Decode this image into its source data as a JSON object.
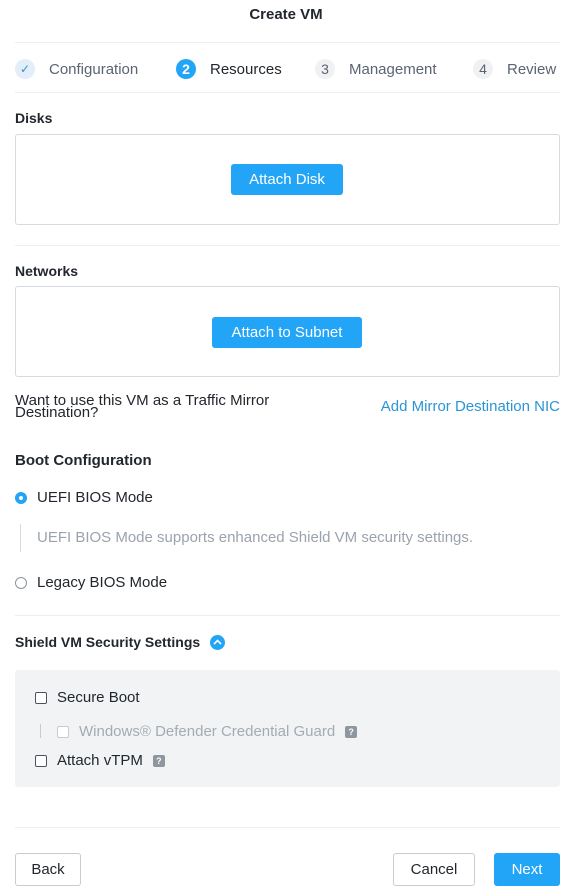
{
  "modal": {
    "title": "Create VM"
  },
  "stepper": {
    "steps": [
      {
        "label": "Configuration",
        "marker": "✓",
        "state": "done"
      },
      {
        "label": "Resources",
        "marker": "2",
        "state": "active"
      },
      {
        "label": "Management",
        "marker": "3",
        "state": "todo"
      },
      {
        "label": "Review",
        "marker": "4",
        "state": "todo"
      }
    ]
  },
  "disks": {
    "label": "Disks",
    "button": "Attach Disk"
  },
  "networks": {
    "label": "Networks",
    "button": "Attach to Subnet"
  },
  "mirror": {
    "question": "Want to use this VM as a Traffic Mirror Destination?",
    "link": "Add Mirror Destination NIC"
  },
  "boot": {
    "label": "Boot Configuration",
    "options": [
      {
        "label": "UEFI BIOS Mode",
        "selected": true
      },
      {
        "label": "Legacy BIOS Mode",
        "selected": false
      }
    ],
    "uefi_description": "UEFI BIOS Mode supports enhanced Shield VM security settings."
  },
  "shield": {
    "label": "Shield VM Security Settings",
    "secure_boot": "Secure Boot",
    "credential_guard": "Windows® Defender Credential Guard",
    "vtpm": "Attach vTPM",
    "help_marker": "?"
  },
  "footer": {
    "back": "Back",
    "cancel": "Cancel",
    "next": "Next"
  },
  "colors": {
    "accent": "#22a5f7",
    "link": "#2b95d3",
    "panel": "#f2f3f4",
    "border": "#d7dbe0"
  }
}
